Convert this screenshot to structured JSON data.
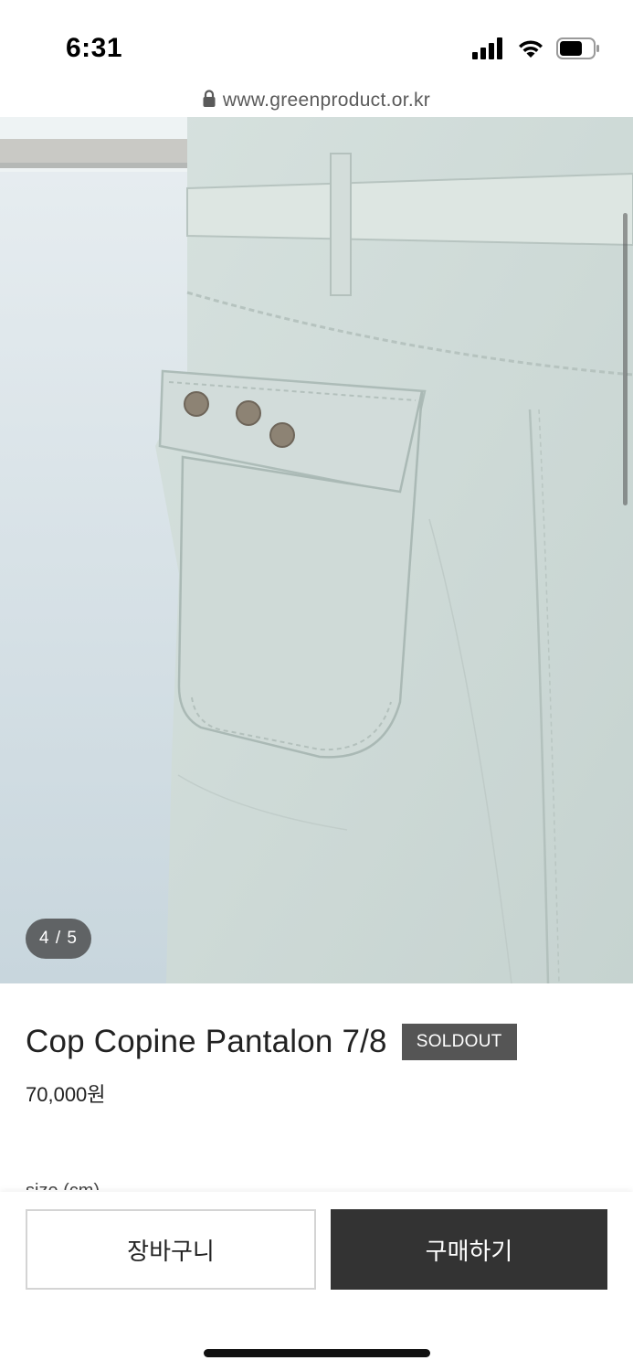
{
  "status_bar": {
    "time": "6:31",
    "icons": [
      "signal-icon",
      "wifi-icon",
      "battery-icon"
    ]
  },
  "url_bar": {
    "icon": "lock-icon",
    "url": "www.greenproduct.or.kr"
  },
  "gallery": {
    "indicator": "4 / 5"
  },
  "product": {
    "name": "Cop Copine Pantalon 7/8",
    "badge": "SOLDOUT",
    "price": "70,000원",
    "size_label": "size (cm)"
  },
  "actions": {
    "cart_label": "장바구니",
    "buy_label": "구매하기"
  },
  "colors": {
    "badge_bg": "#555555",
    "buy_button_bg": "#333333",
    "fabric": "#cdd9d6"
  }
}
